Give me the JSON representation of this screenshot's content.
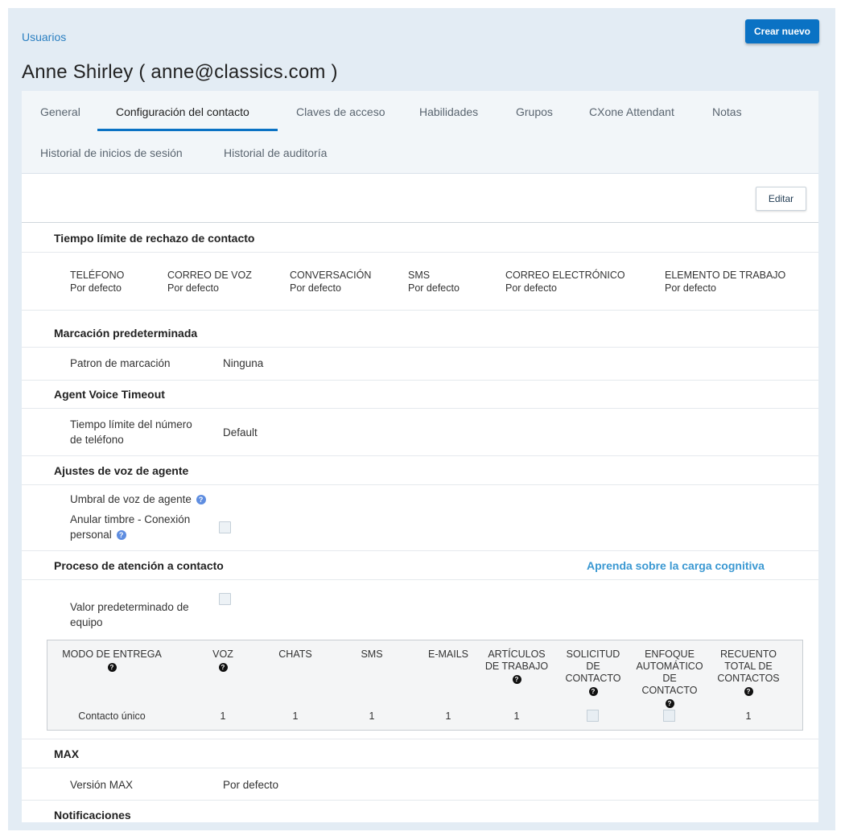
{
  "breadcrumb": "Usuarios",
  "create_button": "Crear nuevo",
  "title": "Anne Shirley ( anne@classics.com )",
  "tabs": [
    {
      "label": "General"
    },
    {
      "label": "Configuración del contacto"
    },
    {
      "label": "Claves de acceso"
    },
    {
      "label": "Habilidades"
    },
    {
      "label": "Grupos"
    },
    {
      "label": "CXone Attendant"
    },
    {
      "label": "Notas"
    },
    {
      "label": "Historial de inicios de sesión"
    },
    {
      "label": "Historial de auditoría"
    }
  ],
  "active_tab": "Configuración del contacto",
  "edit_button": "Editar",
  "rejection_timeout": {
    "title": "Tiempo límite de rechazo de contacto",
    "columns": [
      {
        "label": "TELÉFONO",
        "value": "Por defecto"
      },
      {
        "label": "CORREO DE VOZ",
        "value": "Por defecto"
      },
      {
        "label": "CONVERSACIÓN",
        "value": "Por defecto"
      },
      {
        "label": "SMS",
        "value": "Por defecto"
      },
      {
        "label": "CORREO ELECTRÓNICO",
        "value": "Por defecto"
      },
      {
        "label": "ELEMENTO DE TRABAJO",
        "value": "Por defecto"
      }
    ]
  },
  "default_dialing": {
    "title": "Marcación predeterminada",
    "label": "Patron de marcación",
    "value": "Ninguna"
  },
  "agent_voice_timeout": {
    "title": "Agent Voice Timeout",
    "label_line1": "Tiempo límite del número",
    "label_line2": "de teléfono",
    "value": "Default"
  },
  "agent_voice_settings": {
    "title": "Ajustes de voz de agente",
    "threshold_label": "Umbral de voz de agente",
    "override_line1": "Anular timbre - Conexión",
    "override_line2": "personal"
  },
  "contact_handling": {
    "title": "Proceso de atención a contacto",
    "learn_link": "Aprenda sobre la carga cognitiva",
    "team_default_line1": "Valor predeterminado de",
    "team_default_line2": "equipo",
    "table": {
      "headers": {
        "mode": [
          "MODO DE ENTREGA"
        ],
        "voice": [
          "VOZ"
        ],
        "chats": [
          "CHATS"
        ],
        "sms": [
          "SMS"
        ],
        "emails": [
          "E-MAILS"
        ],
        "work_items": [
          "ARTÍCULOS",
          "DE TRABAJO"
        ],
        "request": [
          "SOLICITUD",
          "DE",
          "CONTACTO"
        ],
        "auto_focus": [
          "ENFOQUE",
          "AUTOMÁTICO",
          "DE",
          "CONTACTO"
        ],
        "total": [
          "RECUENTO",
          "TOTAL DE",
          "CONTACTOS"
        ]
      },
      "row": {
        "mode": "Contacto único",
        "voice": "1",
        "chats": "1",
        "sms": "1",
        "emails": "1",
        "work_items": "1",
        "total": "1"
      }
    }
  },
  "max": {
    "title": "MAX",
    "label": "Versión MAX",
    "value": "Por defecto"
  },
  "notifications": {
    "title": "Notificaciones"
  },
  "colors": {
    "accent": "#0a72c4",
    "link": "#3a98d2",
    "background": "#e3ecf4"
  }
}
